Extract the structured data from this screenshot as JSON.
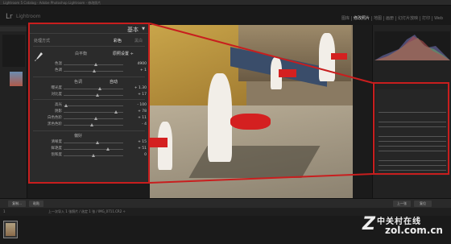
{
  "window": {
    "title": "Lightroom 5 Catalog - Adobe Photoshop Lightroom - 修改照片"
  },
  "app": {
    "logo": "Lr",
    "logo_sub": "Lightroom"
  },
  "modules": [
    "图库",
    "修改照片",
    "地图",
    "画册",
    "幻灯片放映",
    "打印",
    "Web"
  ],
  "active_module": "修改照片",
  "panel": {
    "title": "基本",
    "collapse_icon": "triangle-down-icon",
    "treatment_label": "处理方式",
    "treatment_color": "彩色",
    "treatment_bw": "黑白",
    "wb_label": "白平衡",
    "wb_value": "原照设置 ÷",
    "tone_label": "色调",
    "tone_auto": "自动",
    "presence_label": "偏好",
    "sliders_wb": [
      {
        "label": "色温",
        "value": "4900",
        "pos": 0.55
      },
      {
        "label": "色调",
        "value": "+ 1",
        "pos": 0.52
      }
    ],
    "sliders_tone": [
      {
        "label": "曝光度",
        "value": "+ 1.30",
        "pos": 0.62
      },
      {
        "label": "对比度",
        "value": "+ 17",
        "pos": 0.57
      }
    ],
    "sliders_tone2": [
      {
        "label": "高光",
        "value": "- 100",
        "pos": 0.05
      },
      {
        "label": "阴影",
        "value": "+ 78",
        "pos": 0.88
      },
      {
        "label": "白色色阶",
        "value": "+ 11",
        "pos": 0.55
      },
      {
        "label": "黑色色阶",
        "value": "- 4",
        "pos": 0.48
      }
    ],
    "sliders_presence": [
      {
        "label": "清晰度",
        "value": "+ 15",
        "pos": 0.57
      },
      {
        "label": "鲜艳度",
        "value": "+ 51",
        "pos": 0.75
      },
      {
        "label": "饱和度",
        "value": "0",
        "pos": 0.5
      }
    ]
  },
  "bottom": {
    "left_btn1": "复制...",
    "left_btn2": "粘贴",
    "right_btn1": "上一张",
    "right_btn2": "复位"
  },
  "filmstrip": {
    "info": "上一次导入   1 张照片 / 选定 1 张 / IMG_0711.CR2 ÷",
    "page": "1"
  },
  "watermark": {
    "brand": "中关村在线",
    "url": "zol.com.cn",
    "mark": "Z"
  },
  "colors": {
    "accent": "#c81e1e",
    "panel_bg": "#2b2b2b",
    "app_bg": "#1b1b1b"
  }
}
